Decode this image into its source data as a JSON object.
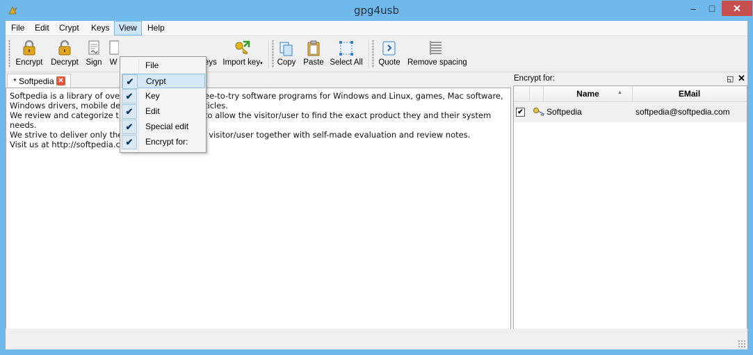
{
  "window": {
    "title": "gpg4usb",
    "min_glyph": "–",
    "max_glyph": "□",
    "close_glyph": "✕"
  },
  "menubar": {
    "items": [
      "File",
      "Edit",
      "Crypt",
      "Keys",
      "View",
      "Help"
    ]
  },
  "toolbar": {
    "buttons": {
      "encrypt": "Encrypt",
      "decrypt": "Decrypt",
      "sign": "Sign",
      "verify_partial": "W",
      "append_keys_partial": "keys",
      "import_key": "Import key",
      "copy": "Copy",
      "paste": "Paste",
      "select_all": "Select All",
      "quote": "Quote",
      "remove_spacing": "Remove spacing"
    }
  },
  "tab": {
    "label": "* Softpedia",
    "close": "✕"
  },
  "editor": {
    "lines": [
      "Softpedia is a library of over",
      "Windows drivers, mobile dev",
      "We review and categorize t",
      "needs.",
      "We strive to deliver only the best products to the visitor/user together with self-made evaluation and review notes.",
      "Visit us at http://softpedia.com"
    ],
    "lines_right": [
      "ee-to-try software programs for Windows and Linux, games, Mac software,",
      "ticles.",
      "to allow the visitor/user to find the exact product they and their system"
    ]
  },
  "panel": {
    "title": "Encrypt for:",
    "float_glyph": "◱",
    "close_glyph": "✕",
    "columns": [
      "Name",
      "EMail"
    ],
    "rows": [
      {
        "checked": true,
        "name": "Softpedia",
        "email": "softpedia@softpedia.com"
      }
    ]
  },
  "view_menu": {
    "items": [
      {
        "label": "File",
        "checked": false
      },
      {
        "label": "Crypt",
        "checked": true
      },
      {
        "label": "Key",
        "checked": true
      },
      {
        "label": "Edit",
        "checked": true
      },
      {
        "label": "Special edit",
        "checked": true
      },
      {
        "label": "Encrypt for:",
        "checked": true
      }
    ],
    "check_glyph": "✔"
  },
  "colors": {
    "titlebar": "#6fb9ec",
    "close_button": "#c7504f",
    "menu_highlight": "#cde6f7",
    "tab_close": "#e0563d",
    "lock_gold": "#e0a620"
  }
}
